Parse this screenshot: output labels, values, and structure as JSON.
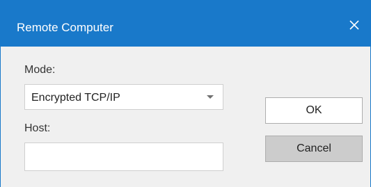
{
  "window": {
    "title": "Remote Computer",
    "close_icon": "close-icon"
  },
  "form": {
    "mode_label": "Mode:",
    "mode_value": "Encrypted TCP/IP",
    "host_label": "Host:",
    "host_value": "",
    "host_placeholder": ""
  },
  "buttons": {
    "ok_label": "OK",
    "cancel_label": "Cancel"
  },
  "colors": {
    "titlebar": "#1979ca",
    "body": "#f0f0f0",
    "cancel_bg": "#cccccc"
  }
}
